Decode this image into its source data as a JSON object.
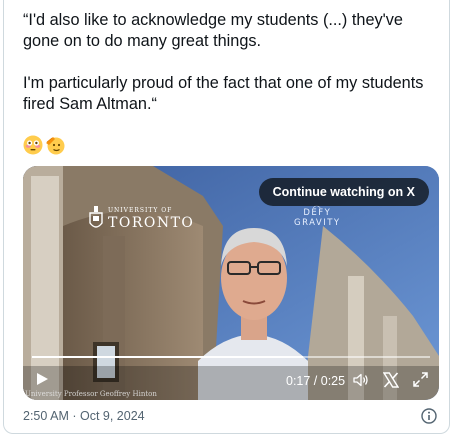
{
  "tweet": {
    "text": "“I'd also like to acknowledge my students (...) they've gone on to do many great things.\n\nI'm particularly proud of the fact that one of my students fired Sam Altman.“",
    "emojis": [
      "flushed-face-icon",
      "saluting-face-icon"
    ],
    "timestamp": "2:50 AM · Oct 9, 2024"
  },
  "video": {
    "continue_label": "Continue watching on X",
    "time_display": "0:17 / 0:25",
    "progress": 0.68,
    "caption": "University Professor Geoffrey Hinton",
    "logo_small": "UNIVERSITY OF",
    "logo_big": "TORONTO",
    "defy_line1": "DEFY",
    "defy_line2": "GRAVITY"
  },
  "colors": {
    "sky": "#4d6fb0",
    "text_secondary": "#536471",
    "border": "#cfd9de"
  }
}
